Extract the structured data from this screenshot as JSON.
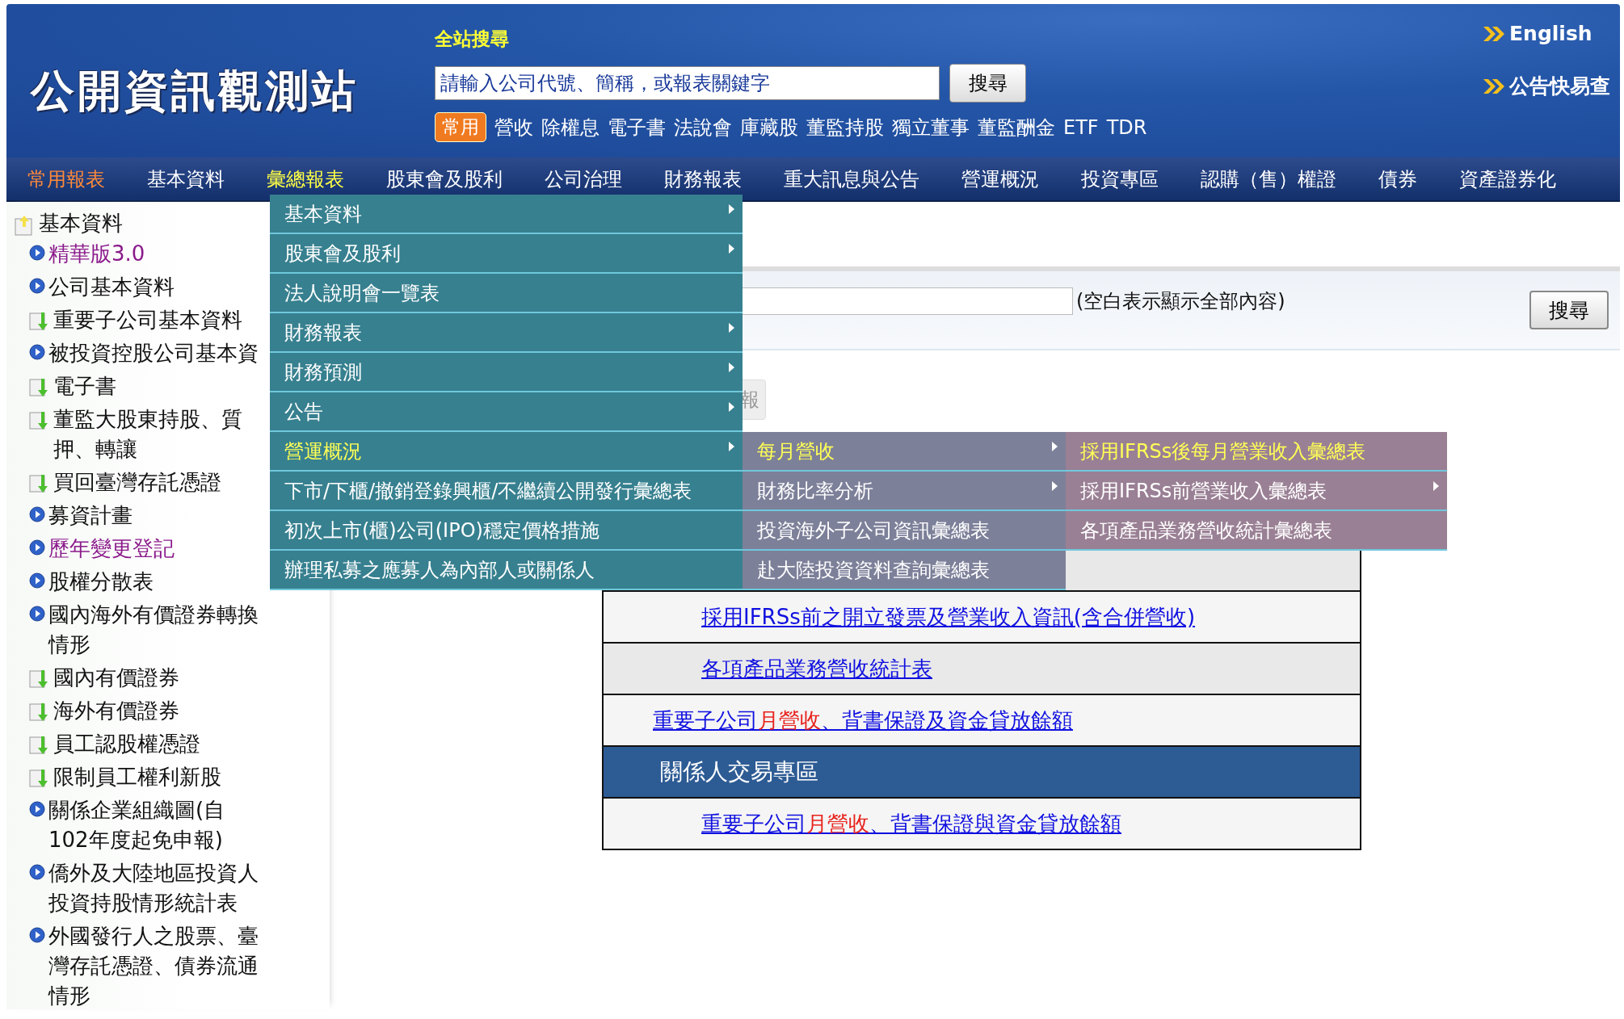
{
  "header": {
    "logo": "公開資訊觀測站",
    "search_title": "全站搜尋",
    "search": {
      "placeholder": "請輸入公司代號、簡稱，或報表關鍵字"
    },
    "search_button": "搜尋",
    "badge": "常用",
    "quick_links": [
      "營收",
      "除權息",
      "電子書",
      "法說會",
      "庫藏股",
      "董監持股",
      "獨立董事",
      "董監酬金",
      "ETF",
      "TDR"
    ],
    "right_links": [
      "English",
      "公告快易查"
    ]
  },
  "nav": [
    {
      "label": "常用報表",
      "featured": true,
      "selected": false
    },
    {
      "label": "基本資料",
      "featured": false,
      "selected": false
    },
    {
      "label": "彙總報表",
      "featured": false,
      "selected": true
    },
    {
      "label": "股東會及股利",
      "featured": false,
      "selected": false
    },
    {
      "label": "公司治理",
      "featured": false,
      "selected": false
    },
    {
      "label": "財務報表",
      "featured": false,
      "selected": false
    },
    {
      "label": "重大訊息與公告",
      "featured": false,
      "selected": false
    },
    {
      "label": "營運概況",
      "featured": false,
      "selected": false
    },
    {
      "label": "投資專區",
      "featured": false,
      "selected": false
    },
    {
      "label": "認購（售）權證",
      "featured": false,
      "selected": false
    },
    {
      "label": "債券",
      "featured": false,
      "selected": false
    },
    {
      "label": "資產證券化",
      "featured": false,
      "selected": false
    }
  ],
  "dropdown_menu": [
    {
      "label": "基本資料",
      "has_submenu": true,
      "selected": false
    },
    {
      "label": "股東會及股利",
      "has_submenu": true,
      "selected": false
    },
    {
      "label": "法人說明會一覽表",
      "has_submenu": false,
      "selected": false
    },
    {
      "label": "財務報表",
      "has_submenu": true,
      "selected": false
    },
    {
      "label": "財務預測",
      "has_submenu": true,
      "selected": false
    },
    {
      "label": "公告",
      "has_submenu": true,
      "selected": false
    },
    {
      "label": "營運概況",
      "has_submenu": true,
      "selected": true,
      "submenu": [
        {
          "label": "每月營收",
          "has_submenu": true,
          "selected": true,
          "submenu": [
            {
              "label": "採用IFRSs後每月營業收入彙總表",
              "has_submenu": false,
              "selected": true
            },
            {
              "label": "採用IFRSs前營業收入彙總表",
              "has_submenu": true,
              "selected": false
            },
            {
              "label": "各項產品業務營收統計彙總表",
              "has_submenu": false,
              "selected": false
            }
          ]
        },
        {
          "label": "財務比率分析",
          "has_submenu": true,
          "selected": false
        },
        {
          "label": "投資海外子公司資訊彙總表",
          "has_submenu": false,
          "selected": false
        },
        {
          "label": "赴大陸投資資料查詢彙總表",
          "has_submenu": false,
          "selected": false
        }
      ]
    },
    {
      "label": "下市/下櫃/撤銷登錄興櫃/不繼續公開發行彙總表",
      "has_submenu": false,
      "selected": false
    },
    {
      "label": "初次上市(櫃)公司(IPO)穩定價格措施",
      "has_submenu": false,
      "selected": false
    },
    {
      "label": "辦理私募之應募人為內部人或關係人",
      "has_submenu": false,
      "selected": false
    }
  ],
  "sidebar": [
    {
      "label": "基本資料",
      "kind": "folder",
      "visited": false,
      "children": [
        {
          "label": "精華版3.0",
          "kind": "bullet",
          "visited": true
        },
        {
          "label": "公司基本資料",
          "kind": "bullet",
          "visited": false
        },
        {
          "label": "重要子公司基本資料",
          "kind": "download",
          "visited": false
        },
        {
          "label": "被投資控股公司基本資",
          "kind": "bullet",
          "visited": false
        },
        {
          "label": "電子書",
          "kind": "download",
          "visited": false
        },
        {
          "label": "董監大股東持股、質押、轉讓",
          "kind": "download",
          "visited": false
        },
        {
          "label": "買回臺灣存託憑證",
          "kind": "download",
          "visited": false
        },
        {
          "label": "募資計畫",
          "kind": "bullet",
          "visited": false
        },
        {
          "label": "歷年變更登記",
          "kind": "bullet",
          "visited": true
        },
        {
          "label": "股權分散表",
          "kind": "bullet",
          "visited": false
        },
        {
          "label": "國內海外有價證券轉換情形",
          "kind": "bullet",
          "visited": false
        },
        {
          "label": "國內有價證券",
          "kind": "download",
          "visited": false
        },
        {
          "label": "海外有價證券",
          "kind": "download",
          "visited": false
        },
        {
          "label": "員工認股權憑證",
          "kind": "download",
          "visited": false
        },
        {
          "label": "限制員工權利新股",
          "kind": "download",
          "visited": false
        },
        {
          "label": "關係企業組織圖(自102年度起免申報)",
          "kind": "bullet",
          "visited": false
        },
        {
          "label": "僑外及大陸地區投資人投資持股情形統計表",
          "kind": "bullet",
          "visited": false
        },
        {
          "label": "外國發行人之股票、臺灣存託憑證、債券流通情形",
          "kind": "bullet",
          "visited": false
        }
      ]
    }
  ],
  "filter": {
    "hint": "(空白表示顯示全部內容)",
    "button": "搜尋"
  },
  "partial_button": "報",
  "table": [
    {
      "kind": "blank"
    },
    {
      "kind": "sublink",
      "parts": [
        {
          "text": "採用IFRSs前之開立發票及營業收入資訊(含合併營收)",
          "highlight": false
        }
      ]
    },
    {
      "kind": "sublink",
      "parts": [
        {
          "text": "各項產品業務營收統計表",
          "highlight": false
        }
      ]
    },
    {
      "kind": "link",
      "parts": [
        {
          "text": "重要子公司",
          "highlight": false
        },
        {
          "text": "月營收",
          "highlight": true
        },
        {
          "text": "、背書保證及資金貸放餘額",
          "highlight": false
        }
      ]
    },
    {
      "kind": "header",
      "text": "關係人交易專區"
    },
    {
      "kind": "sublink",
      "parts": [
        {
          "text": "重要子公司",
          "highlight": false
        },
        {
          "text": "月營收",
          "highlight": true
        },
        {
          "text": "、背書保證與資金貸放餘額",
          "highlight": false
        }
      ]
    }
  ]
}
